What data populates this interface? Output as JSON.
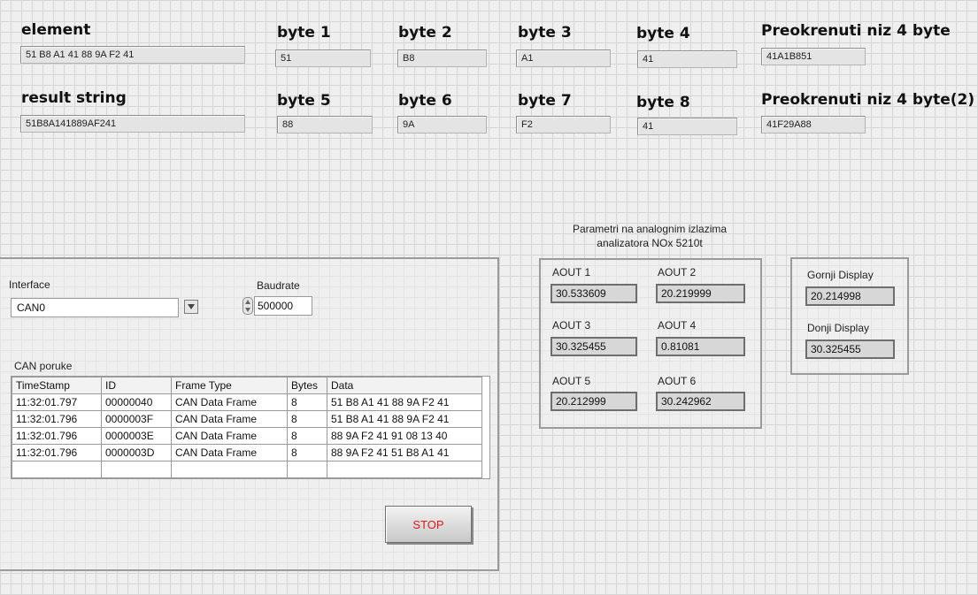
{
  "top": {
    "element_label": "element",
    "element_value": "51 B8 A1 41 88 9A F2 41",
    "result_label": "result string",
    "result_value": "51B8A141889AF241",
    "bytes": [
      {
        "label": "byte 1",
        "value": "51"
      },
      {
        "label": "byte 2",
        "value": "B8"
      },
      {
        "label": "byte 3",
        "value": "A1"
      },
      {
        "label": "byte 4",
        "value": "41"
      },
      {
        "label": "byte 5",
        "value": "88"
      },
      {
        "label": "byte 6",
        "value": "9A"
      },
      {
        "label": "byte 7",
        "value": "F2"
      },
      {
        "label": "byte 8",
        "value": "41"
      }
    ],
    "reversed1_label": "Preokrenuti niz 4 byte",
    "reversed1_value": "41A1B851",
    "reversed2_label": "Preokrenuti niz 4 byte(2)",
    "reversed2_value": "41F29A88"
  },
  "can_panel": {
    "interface_label": "Interface",
    "interface_value": "CAN0",
    "baudrate_label": "Baudrate",
    "baudrate_value": "500000",
    "messages_label": "CAN poruke",
    "columns": [
      "TimeStamp",
      "ID",
      "Frame Type",
      "Bytes",
      "Data"
    ],
    "rows": [
      [
        "11:32:01.797",
        "00000040",
        "CAN Data Frame",
        "8",
        "51 B8 A1 41 88 9A F2 41"
      ],
      [
        "11:32:01.796",
        "0000003F",
        "CAN Data Frame",
        "8",
        "51 B8 A1 41 88 9A F2 41"
      ],
      [
        "11:32:01.796",
        "0000003E",
        "CAN Data Frame",
        "8",
        "88 9A F2 41 91 08 13 40"
      ],
      [
        "11:32:01.796",
        "0000003D",
        "CAN Data Frame",
        "8",
        "88 9A F2 41 51 B8 A1 41"
      ]
    ],
    "stop_label": "STOP"
  },
  "analog": {
    "caption_line1": "Parametri na analognim izlazima",
    "caption_line2": "analizatora NOx 5210t",
    "outputs": [
      {
        "label": "AOUT 1",
        "value": "30.533609"
      },
      {
        "label": "AOUT 2",
        "value": "20.219999"
      },
      {
        "label": "AOUT 3",
        "value": "30.325455"
      },
      {
        "label": "AOUT 4",
        "value": "0.81081"
      },
      {
        "label": "AOUT 5",
        "value": "20.212999"
      },
      {
        "label": "AOUT 6",
        "value": "30.242962"
      }
    ]
  },
  "display": {
    "upper_label": "Gornji Display",
    "upper_value": "20.214998",
    "lower_label": "Donji Display",
    "lower_value": "30.325455"
  }
}
